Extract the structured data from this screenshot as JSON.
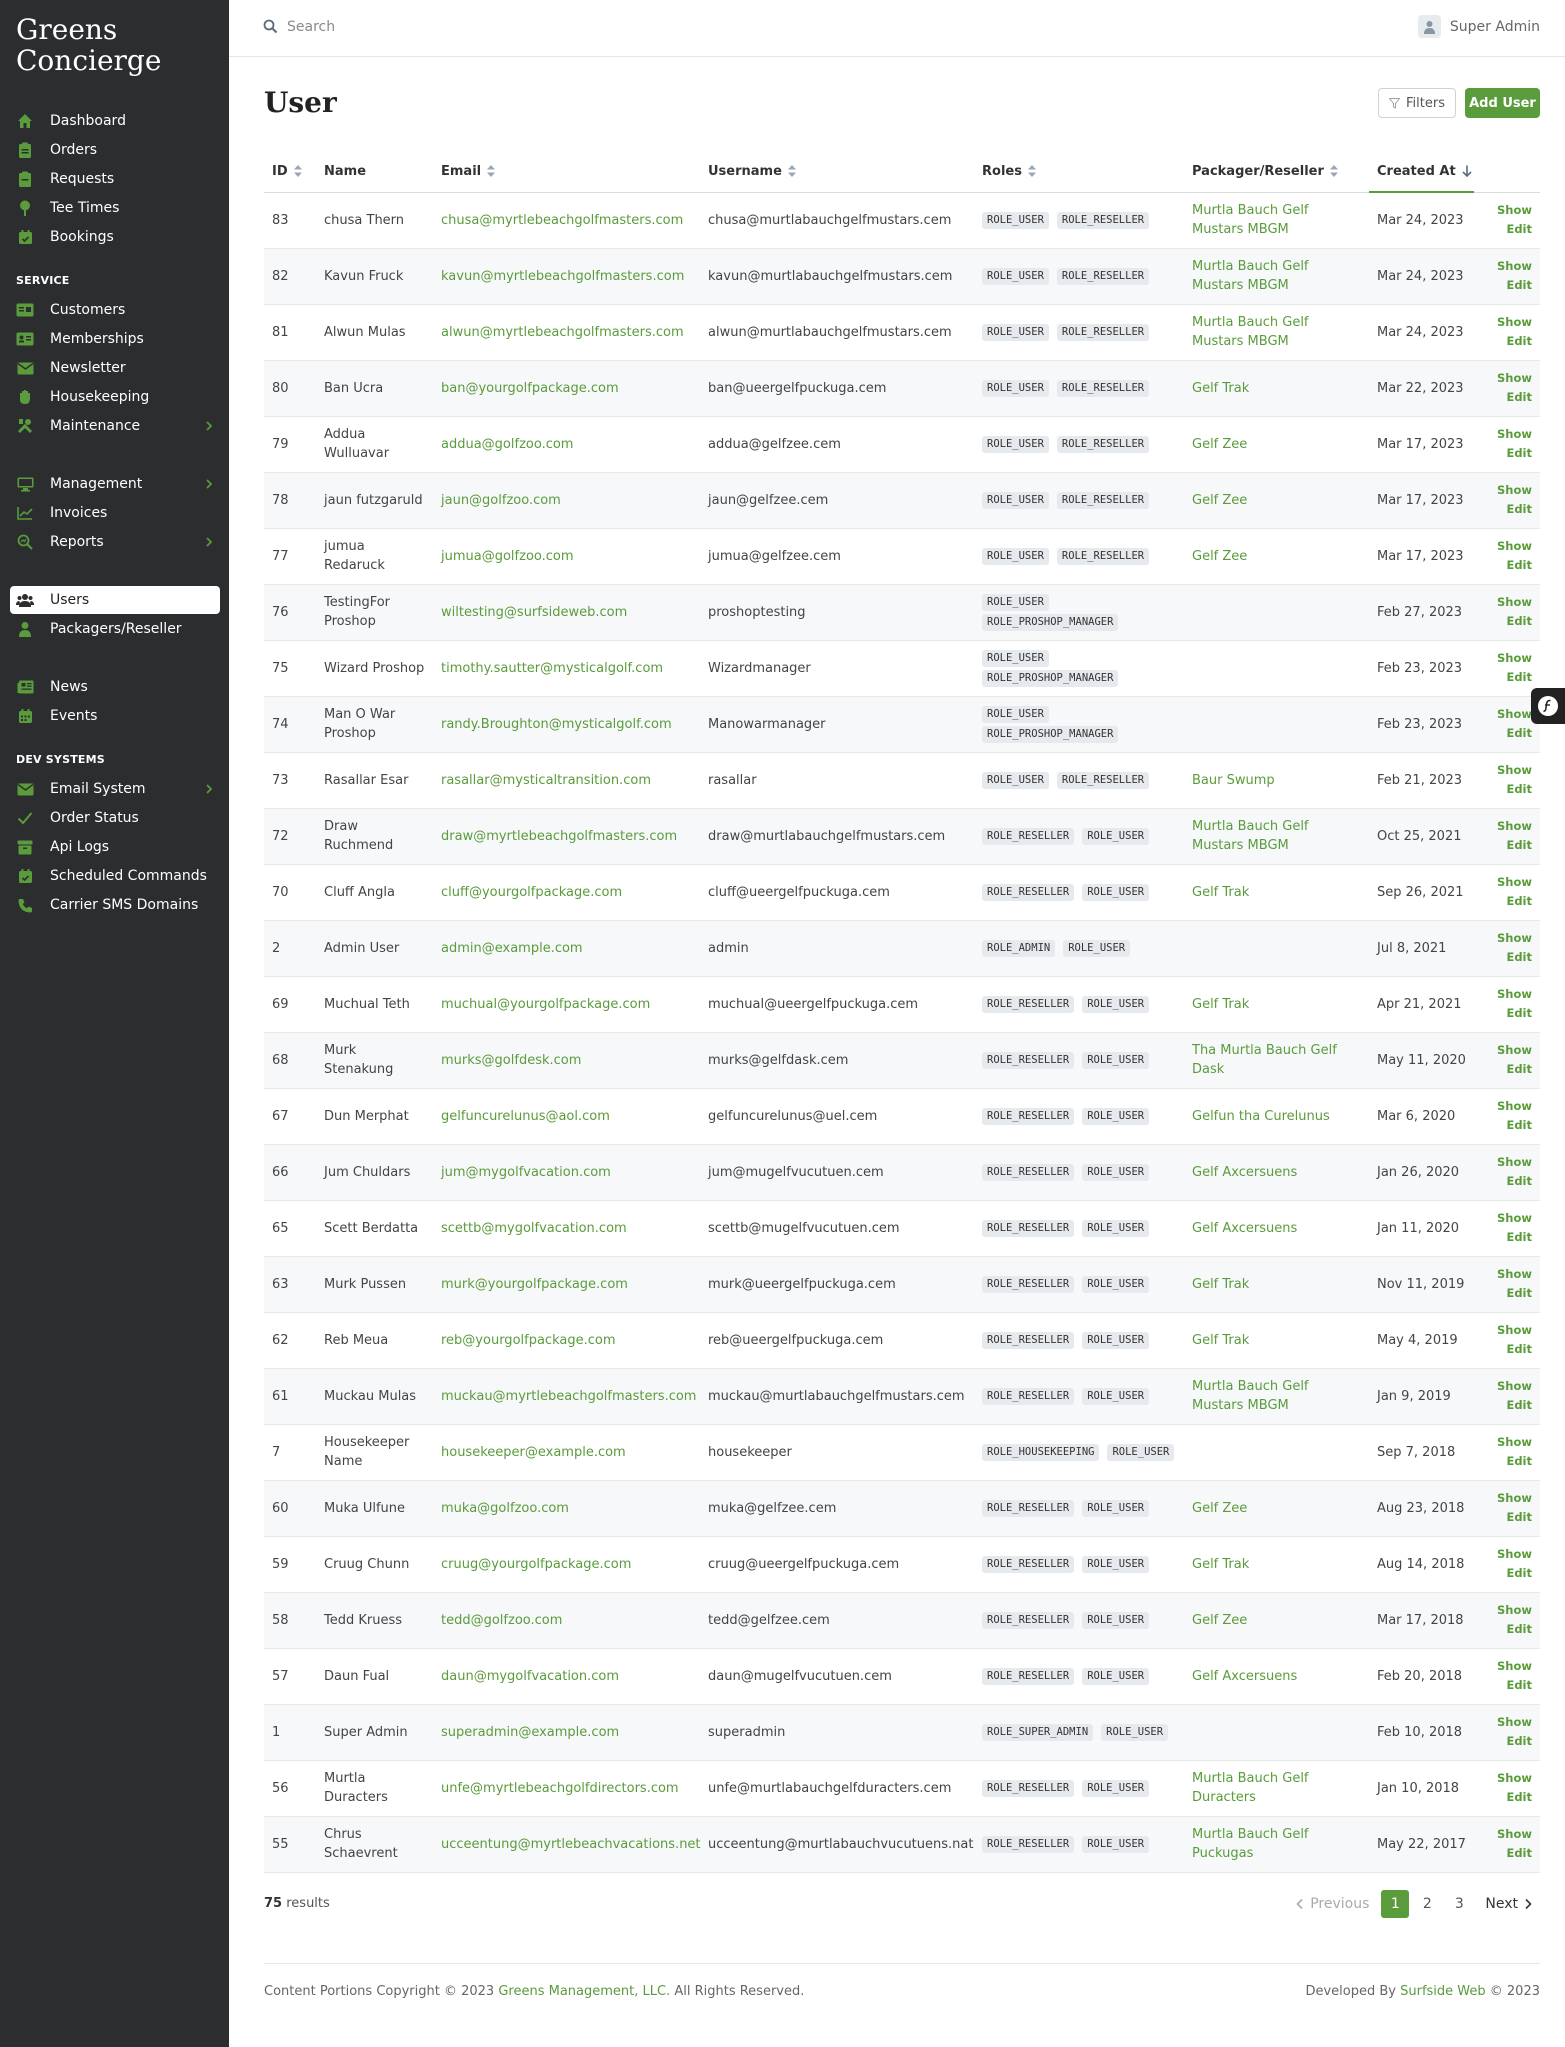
{
  "app": {
    "brand_line1": "Greens",
    "brand_line2": "Concierge"
  },
  "colors": {
    "accent": "#5a9b3c",
    "sidebar_bg": "#2b2d2f",
    "role_badge_bg": "#e6e9ed"
  },
  "sidebar": {
    "main": [
      {
        "label": "Dashboard",
        "icon": "home-icon"
      },
      {
        "label": "Orders",
        "icon": "clipboard-icon"
      },
      {
        "label": "Requests",
        "icon": "inbox-icon"
      },
      {
        "label": "Tee Times",
        "icon": "golf-tee-icon"
      },
      {
        "label": "Bookings",
        "icon": "calendar-check-icon"
      }
    ],
    "service_label": "SERVICE",
    "service": [
      {
        "label": "Customers",
        "icon": "id-card-icon"
      },
      {
        "label": "Memberships",
        "icon": "address-card-icon"
      },
      {
        "label": "Newsletter",
        "icon": "envelope-icon"
      },
      {
        "label": "Housekeeping",
        "icon": "hand-icon"
      },
      {
        "label": "Maintenance",
        "icon": "tools-icon"
      }
    ],
    "admin": [
      {
        "label": "Management",
        "icon": "desktop-icon"
      },
      {
        "label": "Invoices",
        "icon": "chart-line-icon"
      },
      {
        "label": "Reports",
        "icon": "search-chart-icon"
      }
    ],
    "people": [
      {
        "label": "Users",
        "icon": "users-icon"
      },
      {
        "label": "Packagers/Reseller",
        "icon": "user-icon"
      }
    ],
    "content": [
      {
        "label": "News",
        "icon": "newspaper-icon"
      },
      {
        "label": "Events",
        "icon": "calendar-icon"
      }
    ],
    "dev_label": "DEV SYSTEMS",
    "dev": [
      {
        "label": "Email System",
        "icon": "envelope-icon"
      },
      {
        "label": "Order Status",
        "icon": "check-icon"
      },
      {
        "label": "Api Logs",
        "icon": "archive-icon"
      },
      {
        "label": "Scheduled Commands",
        "icon": "calendar-check-icon"
      },
      {
        "label": "Carrier SMS Domains",
        "icon": "phone-icon"
      }
    ]
  },
  "topbar": {
    "search_placeholder": "Search",
    "user_name": "Super Admin"
  },
  "page": {
    "title": "User",
    "filters_label": "Filters",
    "add_label": "Add User"
  },
  "table": {
    "headers": {
      "id": "ID",
      "name": "Name",
      "email": "Email",
      "username": "Username",
      "roles": "Roles",
      "packager": "Packager/Reseller",
      "created": "Created At"
    },
    "show_label": "Show",
    "edit_label": "Edit",
    "rows": [
      {
        "id": "83",
        "name": "chusa Thern",
        "email": "chusa@myrtlebeachgolfmasters.com",
        "username": "chusa@murtlabauchgelfmustars.cem",
        "roles": [
          "ROLE_USER",
          "ROLE_RESELLER"
        ],
        "packager": "Murtla Bauch Gelf Mustars MBGM",
        "created": "Mar 24, 2023"
      },
      {
        "id": "82",
        "name": "Kavun Fruck",
        "email": "kavun@myrtlebeachgolfmasters.com",
        "username": "kavun@murtlabauchgelfmustars.cem",
        "roles": [
          "ROLE_USER",
          "ROLE_RESELLER"
        ],
        "packager": "Murtla Bauch Gelf Mustars MBGM",
        "created": "Mar 24, 2023"
      },
      {
        "id": "81",
        "name": "Alwun Mulas",
        "email": "alwun@myrtlebeachgolfmasters.com",
        "username": "alwun@murtlabauchgelfmustars.cem",
        "roles": [
          "ROLE_USER",
          "ROLE_RESELLER"
        ],
        "packager": "Murtla Bauch Gelf Mustars MBGM",
        "created": "Mar 24, 2023"
      },
      {
        "id": "80",
        "name": "Ban Ucra",
        "email": "ban@yourgolfpackage.com",
        "username": "ban@ueergelfpuckuga.cem",
        "roles": [
          "ROLE_USER",
          "ROLE_RESELLER"
        ],
        "packager": "Gelf Trak",
        "created": "Mar 22, 2023"
      },
      {
        "id": "79",
        "name": "Addua Wulluavar",
        "email": "addua@golfzoo.com",
        "username": "addua@gelfzee.cem",
        "roles": [
          "ROLE_USER",
          "ROLE_RESELLER"
        ],
        "packager": "Gelf Zee",
        "created": "Mar 17, 2023"
      },
      {
        "id": "78",
        "name": "jaun futzgaruld",
        "email": "jaun@golfzoo.com",
        "username": "jaun@gelfzee.cem",
        "roles": [
          "ROLE_USER",
          "ROLE_RESELLER"
        ],
        "packager": "Gelf Zee",
        "created": "Mar 17, 2023"
      },
      {
        "id": "77",
        "name": "jumua Redaruck",
        "email": "jumua@golfzoo.com",
        "username": "jumua@gelfzee.cem",
        "roles": [
          "ROLE_USER",
          "ROLE_RESELLER"
        ],
        "packager": "Gelf Zee",
        "created": "Mar 17, 2023"
      },
      {
        "id": "76",
        "name": "TestingFor Proshop",
        "email": "wiltesting@surfsideweb.com",
        "username": "proshoptesting",
        "roles": [
          "ROLE_USER",
          "ROLE_PROSHOP_MANAGER"
        ],
        "packager": "",
        "created": "Feb 27, 2023"
      },
      {
        "id": "75",
        "name": "Wizard Proshop",
        "email": "timothy.sautter@mysticalgolf.com",
        "username": "Wizardmanager",
        "roles": [
          "ROLE_USER",
          "ROLE_PROSHOP_MANAGER"
        ],
        "packager": "",
        "created": "Feb 23, 2023"
      },
      {
        "id": "74",
        "name": "Man O War Proshop",
        "email": "randy.Broughton@mysticalgolf.com",
        "username": "Manowarmanager",
        "roles": [
          "ROLE_USER",
          "ROLE_PROSHOP_MANAGER"
        ],
        "packager": "",
        "created": "Feb 23, 2023"
      },
      {
        "id": "73",
        "name": "Rasallar Esar",
        "email": "rasallar@mysticaltransition.com",
        "username": "rasallar",
        "roles": [
          "ROLE_USER",
          "ROLE_RESELLER"
        ],
        "packager": "Baur Swump",
        "created": "Feb 21, 2023"
      },
      {
        "id": "72",
        "name": "Draw Ruchmend",
        "email": "draw@myrtlebeachgolfmasters.com",
        "username": "draw@murtlabauchgelfmustars.cem",
        "roles": [
          "ROLE_RESELLER",
          "ROLE_USER"
        ],
        "packager": "Murtla Bauch Gelf Mustars MBGM",
        "created": "Oct 25, 2021"
      },
      {
        "id": "70",
        "name": "Cluff Angla",
        "email": "cluff@yourgolfpackage.com",
        "username": "cluff@ueergelfpuckuga.cem",
        "roles": [
          "ROLE_RESELLER",
          "ROLE_USER"
        ],
        "packager": "Gelf Trak",
        "created": "Sep 26, 2021"
      },
      {
        "id": "2",
        "name": "Admin User",
        "email": "admin@example.com",
        "username": "admin",
        "roles": [
          "ROLE_ADMIN",
          "ROLE_USER"
        ],
        "packager": "",
        "created": "Jul 8, 2021"
      },
      {
        "id": "69",
        "name": "Muchual Teth",
        "email": "muchual@yourgolfpackage.com",
        "username": "muchual@ueergelfpuckuga.cem",
        "roles": [
          "ROLE_RESELLER",
          "ROLE_USER"
        ],
        "packager": "Gelf Trak",
        "created": "Apr 21, 2021"
      },
      {
        "id": "68",
        "name": "Murk Stenakung",
        "email": "murks@golfdesk.com",
        "username": "murks@gelfdask.cem",
        "roles": [
          "ROLE_RESELLER",
          "ROLE_USER"
        ],
        "packager": "Tha Murtla Bauch Gelf Dask",
        "created": "May 11, 2020"
      },
      {
        "id": "67",
        "name": "Dun Merphat",
        "email": "gelfuncurelunus@aol.com",
        "username": "gelfuncurelunus@uel.cem",
        "roles": [
          "ROLE_RESELLER",
          "ROLE_USER"
        ],
        "packager": "Gelfun tha Curelunus",
        "created": "Mar 6, 2020"
      },
      {
        "id": "66",
        "name": "Jum Chuldars",
        "email": "jum@mygolfvacation.com",
        "username": "jum@mugelfvucutuen.cem",
        "roles": [
          "ROLE_RESELLER",
          "ROLE_USER"
        ],
        "packager": "Gelf Axcersuens",
        "created": "Jan 26, 2020"
      },
      {
        "id": "65",
        "name": "Scett Berdatta",
        "email": "scettb@mygolfvacation.com",
        "username": "scettb@mugelfvucutuen.cem",
        "roles": [
          "ROLE_RESELLER",
          "ROLE_USER"
        ],
        "packager": "Gelf Axcersuens",
        "created": "Jan 11, 2020"
      },
      {
        "id": "63",
        "name": "Murk Pussen",
        "email": "murk@yourgolfpackage.com",
        "username": "murk@ueergelfpuckuga.cem",
        "roles": [
          "ROLE_RESELLER",
          "ROLE_USER"
        ],
        "packager": "Gelf Trak",
        "created": "Nov 11, 2019"
      },
      {
        "id": "62",
        "name": "Reb Meua",
        "email": "reb@yourgolfpackage.com",
        "username": "reb@ueergelfpuckuga.cem",
        "roles": [
          "ROLE_RESELLER",
          "ROLE_USER"
        ],
        "packager": "Gelf Trak",
        "created": "May 4, 2019"
      },
      {
        "id": "61",
        "name": "Muckau Mulas",
        "email": "muckau@myrtlebeachgolfmasters.com",
        "username": "muckau@murtlabauchgelfmustars.cem",
        "roles": [
          "ROLE_RESELLER",
          "ROLE_USER"
        ],
        "packager": "Murtla Bauch Gelf Mustars MBGM",
        "created": "Jan 9, 2019"
      },
      {
        "id": "7",
        "name": "Housekeeper Name",
        "email": "housekeeper@example.com",
        "username": "housekeeper",
        "roles": [
          "ROLE_HOUSEKEEPING",
          "ROLE_USER"
        ],
        "packager": "",
        "created": "Sep 7, 2018"
      },
      {
        "id": "60",
        "name": "Muka Ulfune",
        "email": "muka@golfzoo.com",
        "username": "muka@gelfzee.cem",
        "roles": [
          "ROLE_RESELLER",
          "ROLE_USER"
        ],
        "packager": "Gelf Zee",
        "created": "Aug 23, 2018"
      },
      {
        "id": "59",
        "name": "Cruug Chunn",
        "email": "cruug@yourgolfpackage.com",
        "username": "cruug@ueergelfpuckuga.cem",
        "roles": [
          "ROLE_RESELLER",
          "ROLE_USER"
        ],
        "packager": "Gelf Trak",
        "created": "Aug 14, 2018"
      },
      {
        "id": "58",
        "name": "Tedd Kruess",
        "email": "tedd@golfzoo.com",
        "username": "tedd@gelfzee.cem",
        "roles": [
          "ROLE_RESELLER",
          "ROLE_USER"
        ],
        "packager": "Gelf Zee",
        "created": "Mar 17, 2018"
      },
      {
        "id": "57",
        "name": "Daun Fual",
        "email": "daun@mygolfvacation.com",
        "username": "daun@mugelfvucutuen.cem",
        "roles": [
          "ROLE_RESELLER",
          "ROLE_USER"
        ],
        "packager": "Gelf Axcersuens",
        "created": "Feb 20, 2018"
      },
      {
        "id": "1",
        "name": "Super Admin",
        "email": "superadmin@example.com",
        "username": "superadmin",
        "roles": [
          "ROLE_SUPER_ADMIN",
          "ROLE_USER"
        ],
        "packager": "",
        "created": "Feb 10, 2018"
      },
      {
        "id": "56",
        "name": "Murtla Duracters",
        "email": "unfe@myrtlebeachgolfdirectors.com",
        "username": "unfe@murtlabauchgelfduracters.cem",
        "roles": [
          "ROLE_RESELLER",
          "ROLE_USER"
        ],
        "packager": "Murtla Bauch Gelf Duracters",
        "created": "Jan 10, 2018"
      },
      {
        "id": "55",
        "name": "Chrus Schaevrent",
        "email": "ucceentung@myrtlebeachvacations.net",
        "username": "ucceentung@murtlabauchvucutuens.nat",
        "roles": [
          "ROLE_RESELLER",
          "ROLE_USER"
        ],
        "packager": "Murtla Bauch Gelf Puckugas",
        "created": "May 22, 2017"
      }
    ]
  },
  "results": {
    "count": "75",
    "suffix": "results"
  },
  "pagination": {
    "previous": "Previous",
    "pages": [
      "1",
      "2",
      "3"
    ],
    "current": "1",
    "next": "Next"
  },
  "footer": {
    "left_prefix": "Content Portions Copyright © 2023",
    "left_link": "Greens Management, LLC.",
    "left_suffix": "All Rights Reserved.",
    "right_prefix": "Developed By",
    "right_link": "Surfside Web",
    "right_suffix": "© 2023"
  }
}
